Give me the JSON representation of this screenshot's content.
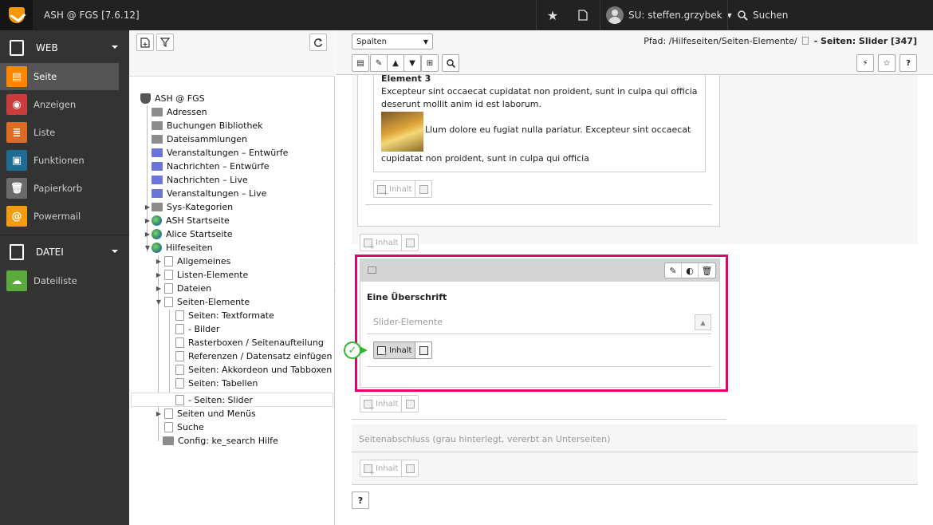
{
  "topbar": {
    "site_title": "ASH @ FGS [7.6.12]",
    "user_label": "SU: steffen.grzybek",
    "search_label": "Suchen"
  },
  "modules": {
    "web_group": "WEB",
    "items": [
      {
        "label": "Seite",
        "color": "#ff8700",
        "icon": "page-icon"
      },
      {
        "label": "Anzeigen",
        "color": "#c83c3c",
        "icon": "eye-icon"
      },
      {
        "label": "Liste",
        "color": "#dd6b25",
        "icon": "list-icon"
      },
      {
        "label": "Funktionen",
        "color": "#1e6b94",
        "icon": "briefcase-icon"
      },
      {
        "label": "Papierkorb",
        "color": "#6b6b6b",
        "icon": "trash-icon"
      },
      {
        "label": "Powermail",
        "color": "#f39c12",
        "icon": "powermail-icon"
      }
    ],
    "file_group": "DATEI",
    "file_items": [
      {
        "label": "Dateiliste",
        "color": "#5aab3b",
        "icon": "cloud-icon"
      }
    ]
  },
  "tree": {
    "root": "ASH @ FGS",
    "nodes": [
      {
        "label": "Adressen",
        "icon": "gray"
      },
      {
        "label": "Buchungen Bibliothek",
        "icon": "gray"
      },
      {
        "label": "Dateisammlungen",
        "icon": "gray"
      },
      {
        "label": "Veranstaltungen – Entwürfe",
        "icon": "blue"
      },
      {
        "label": "Nachrichten – Entwürfe",
        "icon": "blue"
      },
      {
        "label": "Nachrichten – Live",
        "icon": "blue"
      },
      {
        "label": "Veranstaltungen – Live",
        "icon": "blue"
      },
      {
        "label": "Sys-Kategorien",
        "icon": "gray"
      },
      {
        "label": "ASH Startseite",
        "icon": "globe"
      },
      {
        "label": "Alice Startseite",
        "icon": "globe"
      },
      {
        "label": "Hilfeseiten",
        "icon": "globe"
      },
      {
        "label": "Allgemeines",
        "icon": "page"
      },
      {
        "label": "Listen-Elemente",
        "icon": "page"
      },
      {
        "label": "Dateien",
        "icon": "page"
      },
      {
        "label": "Seiten-Elemente",
        "icon": "page"
      },
      {
        "label": "Seiten: Textformate",
        "icon": "page"
      },
      {
        "label": "- Bilder",
        "icon": "page"
      },
      {
        "label": "Rasterboxen / Seitenaufteilung",
        "icon": "page"
      },
      {
        "label": "Referenzen / Datensatz einfügen",
        "icon": "page"
      },
      {
        "label": "Seiten: Akkordeon und Tabboxen",
        "icon": "page"
      },
      {
        "label": "Seiten: Tabellen",
        "icon": "page"
      },
      {
        "label": "- Seiten: Slider",
        "icon": "page"
      },
      {
        "label": "Seiten und Menüs",
        "icon": "page"
      },
      {
        "label": "Suche",
        "icon": "page"
      },
      {
        "label": "Config: ke_search Hilfe",
        "icon": "gray"
      }
    ]
  },
  "doc_header": {
    "view_select": "Spalten",
    "path_prefix": "Pfad: /Hilfeseiten/Seiten-Elemente/",
    "path_page": "- Seiten: Slider [347]"
  },
  "content": {
    "element_title": "Element 3",
    "element_text1": "Excepteur sint occaecat cupidatat non proident, sunt in culpa qui officia deserunt mollit anim id est laborum.",
    "element_text2": "Llum dolore eu fugiat nulla pariatur. Excepteur sint occaecat",
    "element_text3": "cupidatat non proident, sunt in culpa qui officia",
    "btn_inhalt": "Inhalt",
    "heading": "Eine Überschrift",
    "slider_label": "Slider-Elemente",
    "footer_section": "Seitenabschluss (grau hinterlegt, vererbt an Unterseiten)",
    "help": "?"
  },
  "colors": {
    "highlight": "#e6006e",
    "success": "#2eb82e"
  }
}
